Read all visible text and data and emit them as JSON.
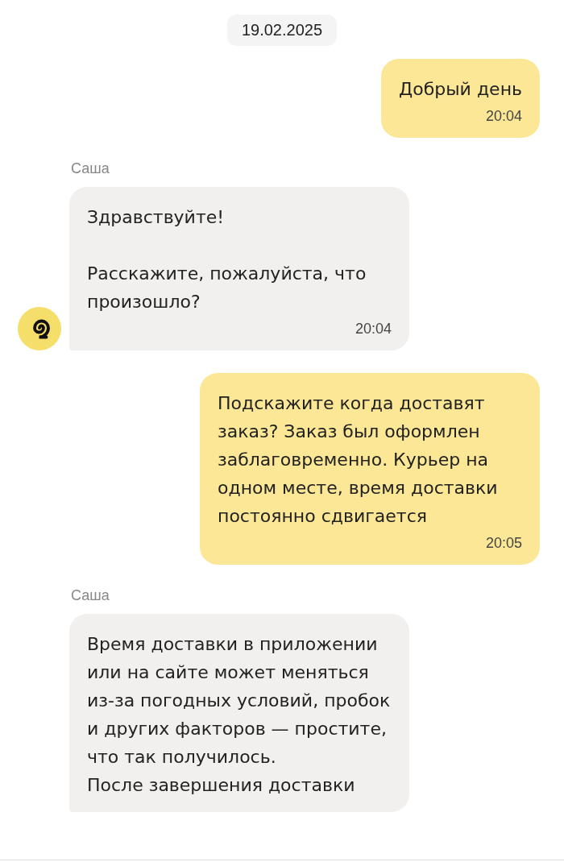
{
  "date": "19.02.2025",
  "messages": [
    {
      "kind": "outgoing",
      "text": "Добрый день",
      "time": "20:04"
    },
    {
      "kind": "incoming",
      "sender": "Саша",
      "avatar": true,
      "text": "Здравствуйте!\n\nРасскажите, пожалуйста, что произошло?",
      "time": "20:04"
    },
    {
      "kind": "outgoing",
      "text": "Подскажите когда доставят заказ? Заказ был оформлен заблаговременно. Курьер на одном месте, время доставки постоянно сдвигается",
      "time": "20:05"
    },
    {
      "kind": "incoming",
      "sender": "Саша",
      "avatar": false,
      "text": "Время доставки в приложении или на сайте может меняться из-за погодных условий, пробок и других факторов — простите, что так получилось.\nПосле завершения доставки"
    }
  ]
}
